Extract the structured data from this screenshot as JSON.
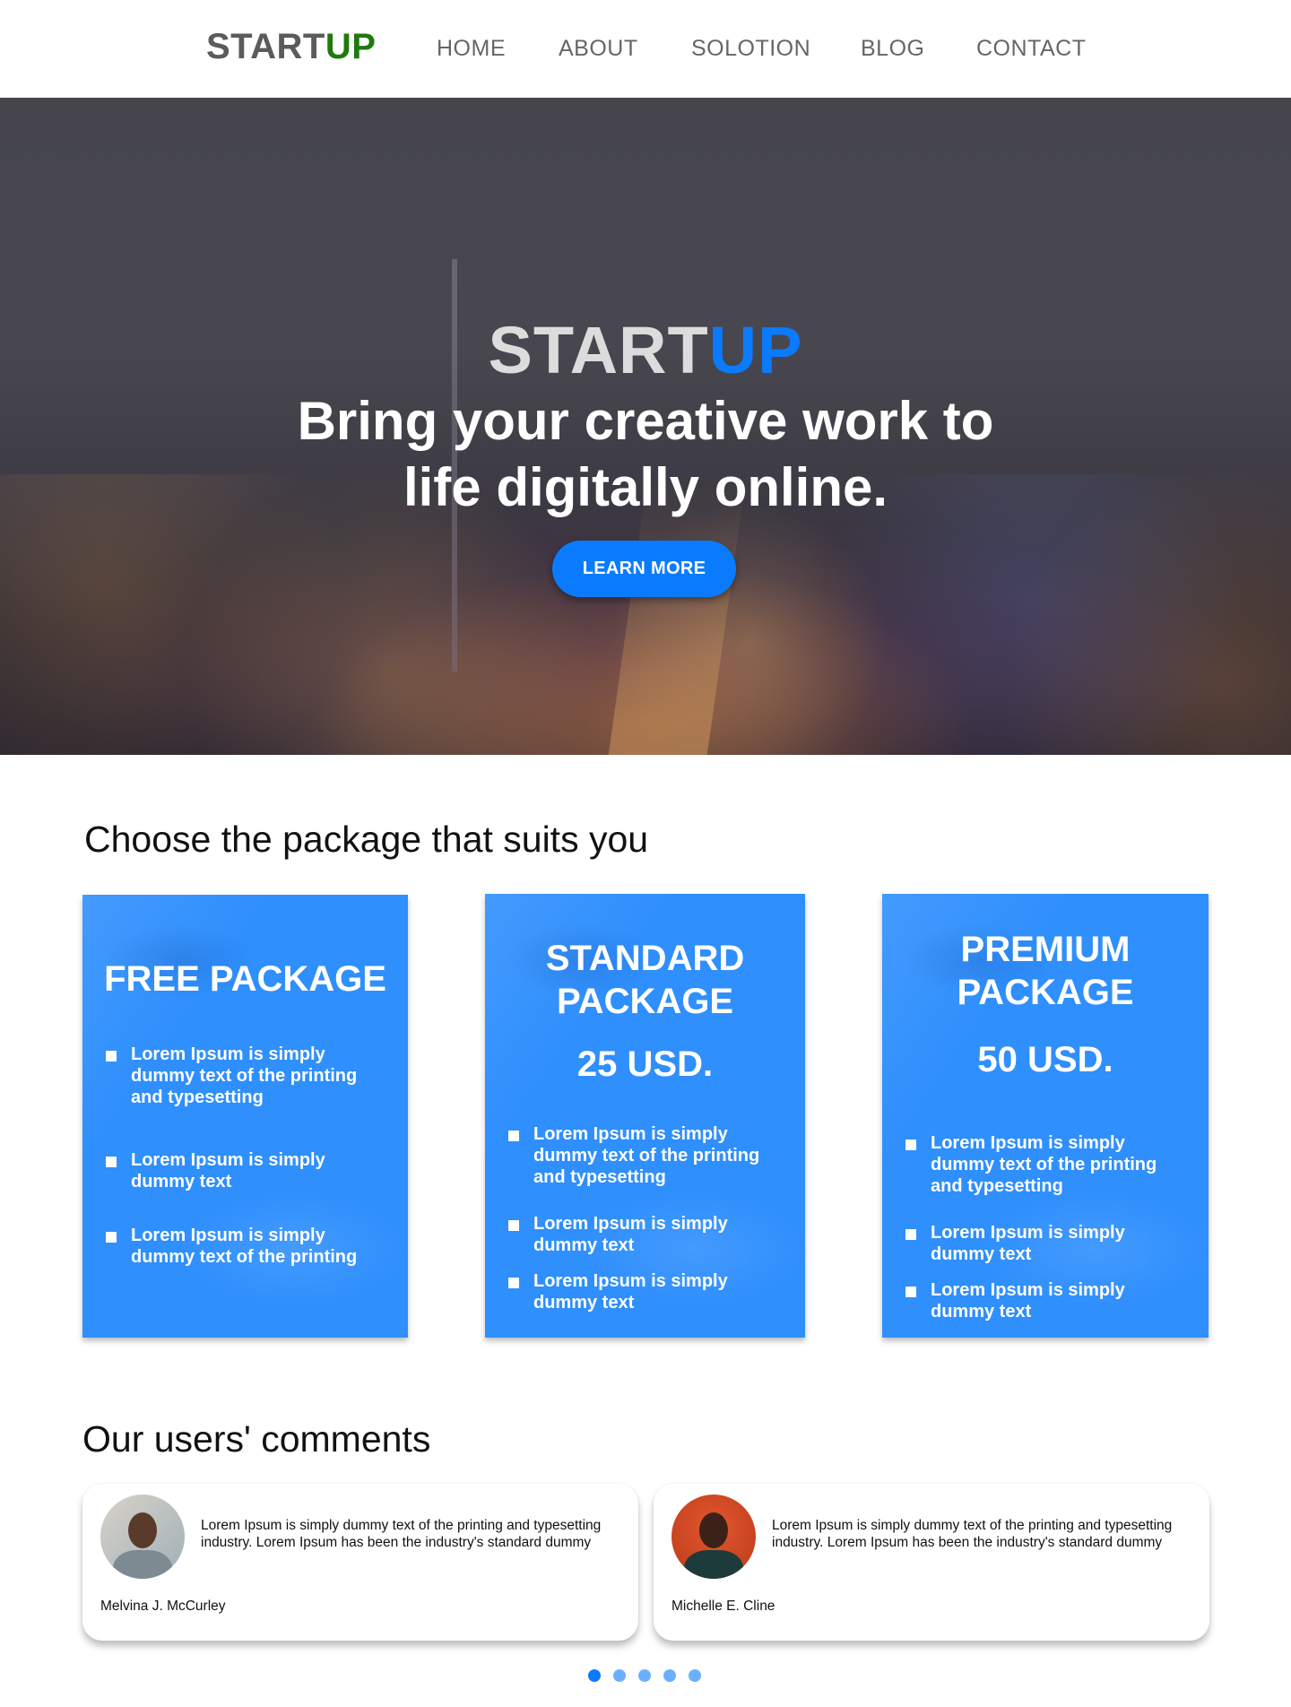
{
  "header": {
    "logo_part1": "START",
    "logo_part2": "UP",
    "nav": [
      "HOME",
      "ABOUT",
      "SOLOTION",
      "BLOG",
      "CONTACT"
    ]
  },
  "hero": {
    "title_part1": "START",
    "title_part2": "UP",
    "subtitle_line1": "Bring your creative work to",
    "subtitle_line2": "life digitally online.",
    "button_label": "LEARN MORE"
  },
  "packages": {
    "heading": "Choose the package that suits you",
    "items": [
      {
        "title_line1": "FREE PACKAGE",
        "title_line2": "",
        "price": "",
        "features": [
          "Lorem Ipsum is simply dummy text of the printing and typesetting",
          "Lorem Ipsum is simply dummy text",
          "Lorem Ipsum is simply dummy text of the printing"
        ]
      },
      {
        "title_line1": "STANDARD",
        "title_line2": "PACKAGE",
        "price": "25 USD.",
        "features": [
          "Lorem Ipsum is simply dummy text of the printing and typesetting",
          "Lorem Ipsum is simply dummy text",
          "Lorem Ipsum is simply dummy text"
        ]
      },
      {
        "title_line1": "PREMIUM",
        "title_line2": "PACKAGE",
        "price": "50 USD.",
        "features": [
          "Lorem Ipsum is simply dummy text of the printing and typesetting",
          "Lorem Ipsum is simply dummy text",
          "Lorem Ipsum is simply dummy text"
        ]
      }
    ]
  },
  "comments": {
    "heading": "Our users' comments",
    "items": [
      {
        "text": "Lorem Ipsum is simply dummy text of the printing and typesetting industry. Lorem Ipsum has been the industry's standard dummy",
        "name": "Melvina J. McCurley"
      },
      {
        "text": "Lorem Ipsum is simply dummy text of the printing and typesetting industry. Lorem Ipsum has been the industry's standard dummy",
        "name": "Michelle E. Cline"
      }
    ],
    "pager": {
      "count": 5,
      "active": 1
    }
  },
  "colors": {
    "brand_blue": "#0a7bff",
    "logo_green": "#1f7a0c",
    "package_blue": "#2f8ffd"
  }
}
